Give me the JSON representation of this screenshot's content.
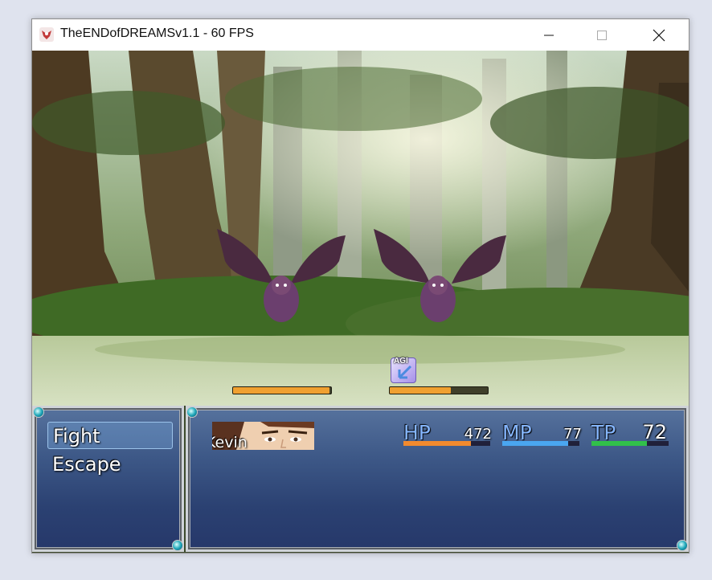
{
  "window": {
    "title": "TheENDofDREAMSv1.1 - 60 FPS"
  },
  "enemies": [
    {
      "name": "bat",
      "hp_fraction": 0.98
    },
    {
      "name": "bat",
      "hp_fraction": 0.62
    }
  ],
  "state_icon": {
    "label": "AGI"
  },
  "commands": [
    {
      "label": "Fight",
      "selected": true
    },
    {
      "label": "Escape",
      "selected": false
    }
  ],
  "actor": {
    "name": "Kevin",
    "hp_label": "HP",
    "hp": "472",
    "hp_fraction": 0.78,
    "mp_label": "MP",
    "mp": "77",
    "mp_fraction": 0.85,
    "tp_label": "TP",
    "tp": "72",
    "tp_fraction": 0.72
  },
  "colors": {
    "hp_gauge": "#f28a2e",
    "mp_gauge": "#4aa6f0",
    "tp_gauge": "#31c04a",
    "enemy_gauge": "#f0a030"
  }
}
